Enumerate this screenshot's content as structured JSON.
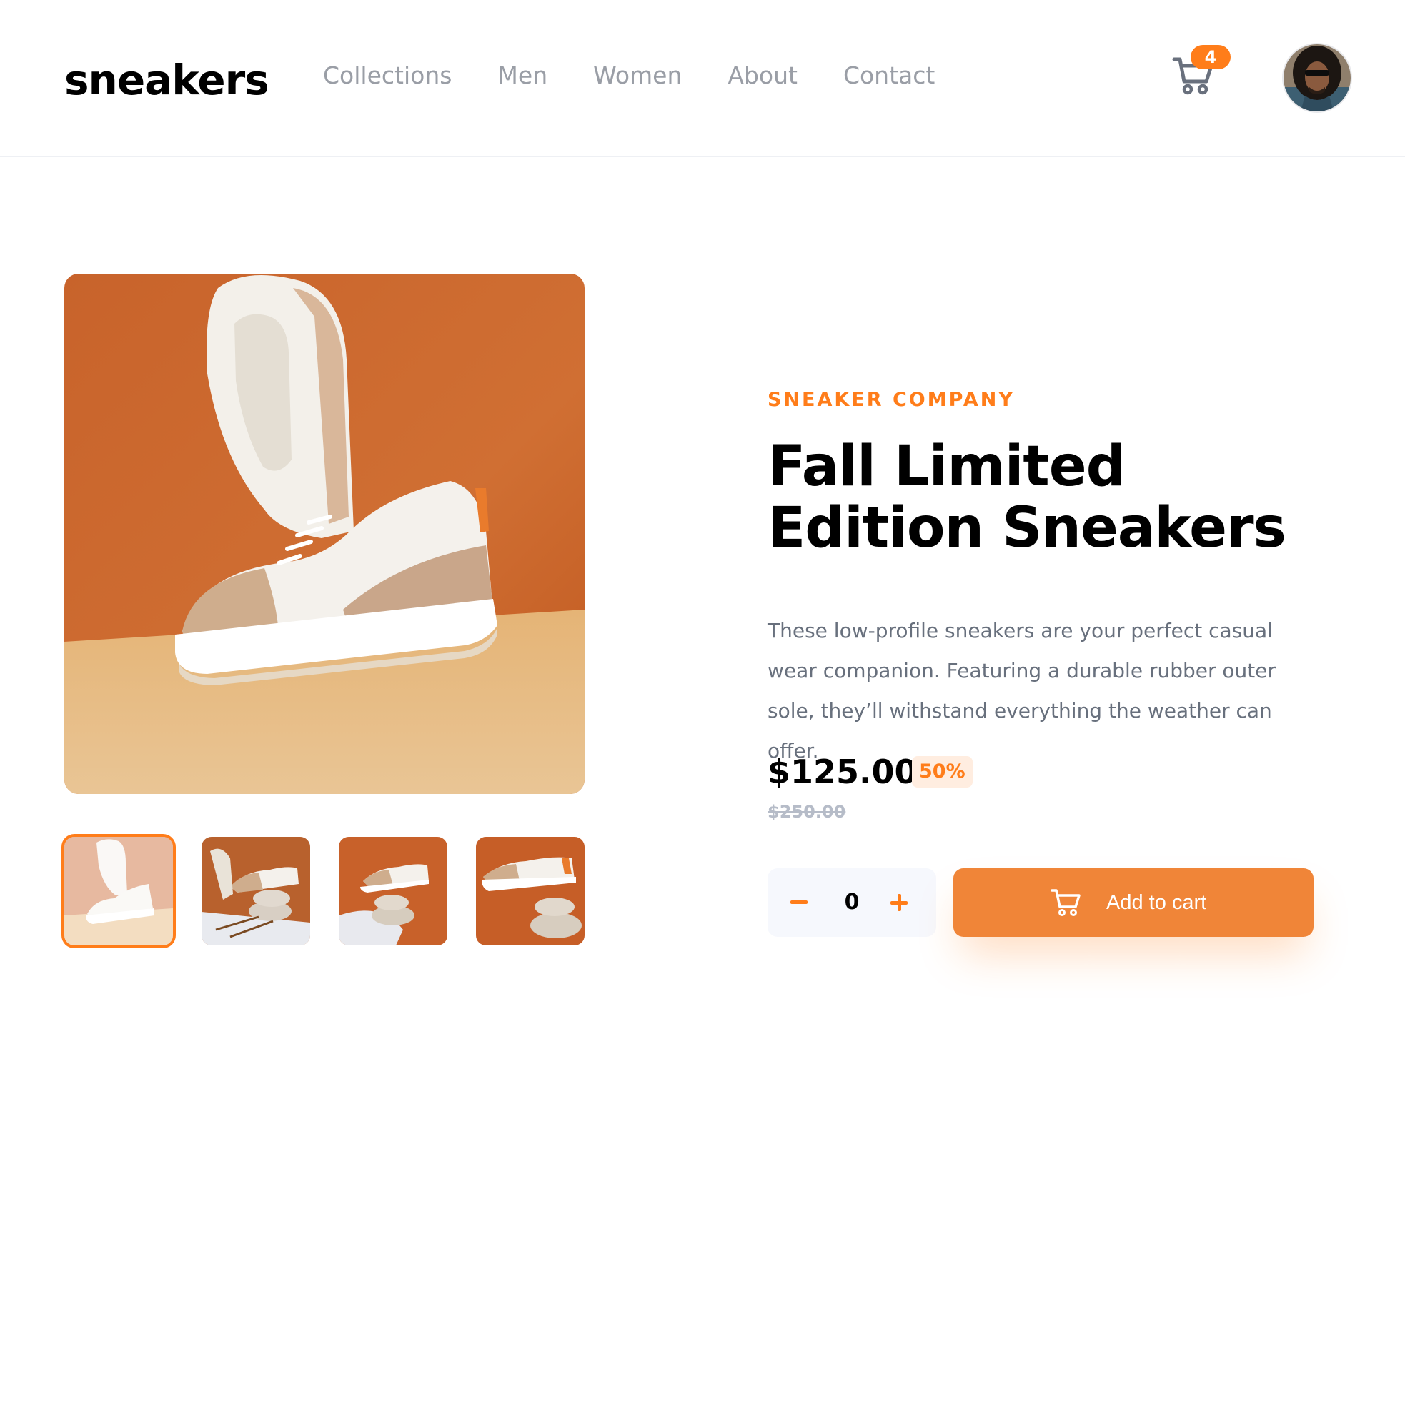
{
  "header": {
    "logo": "sneakers",
    "nav": [
      "Collections",
      "Men",
      "Women",
      "About",
      "Contact"
    ],
    "cart_count": "4",
    "cart_icon": "cart-icon",
    "avatar": "user-avatar"
  },
  "gallery": {
    "thumbnails": [
      "product-thumbnail-1",
      "product-thumbnail-2",
      "product-thumbnail-3",
      "product-thumbnail-4"
    ],
    "active_thumbnail": 1
  },
  "product": {
    "company": "SNEAKER COMPANY",
    "title": "Fall Limited Edition Sneakers",
    "description": "These low-profile sneakers are your perfect casual wear companion. Featuring a durable rubber outer sole, they’ll withstand everything the weather can offer.",
    "price": "$125.00",
    "discount": "50%",
    "original_price": "$250.00"
  },
  "cart_controls": {
    "quantity": "0",
    "minus_icon": "minus-icon",
    "plus_icon": "plus-icon",
    "add_label": "Add to cart"
  },
  "colors": {
    "accent": "#ff7d1a",
    "accent_light": "#ffede0",
    "text_dark": "#1d2026",
    "text_muted": "#68707d",
    "nav_gray": "#9a9ea6"
  }
}
